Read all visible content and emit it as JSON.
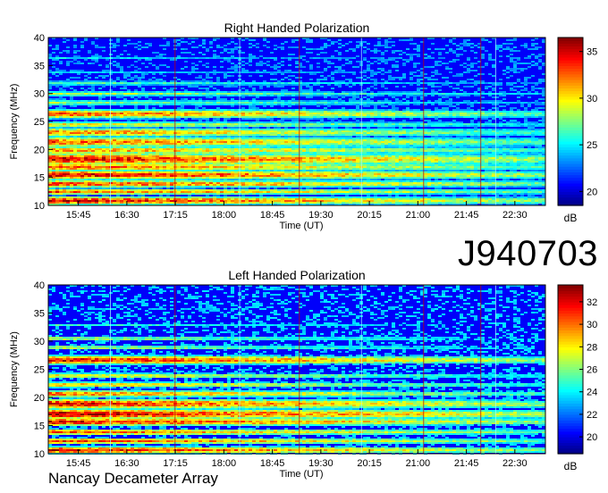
{
  "figure_id": "J940703",
  "footer": "Nancay Decameter Array",
  "chart_data": [
    {
      "type": "heatmap",
      "title": "Right Handed Polarization",
      "xlabel": "Time (UT)",
      "ylabel": "Frequency (MHz)",
      "xticks": [
        "15:45",
        "16:30",
        "17:15",
        "18:00",
        "18:45",
        "19:30",
        "20:15",
        "21:00",
        "21:45",
        "22:30"
      ],
      "yticks": [
        10,
        15,
        20,
        25,
        30,
        35,
        40
      ],
      "ylim": [
        10,
        40
      ],
      "colorbar": {
        "label": "dB",
        "ticks": [
          20,
          25,
          30,
          35
        ],
        "range": [
          18.5,
          36.5
        ]
      },
      "bands": [
        {
          "f": 11.0,
          "w": 0.8,
          "v": 35
        },
        {
          "f": 12.6,
          "w": 0.6,
          "v": 33
        },
        {
          "f": 14.0,
          "w": 0.7,
          "v": 34
        },
        {
          "f": 15.6,
          "w": 0.9,
          "v": 35
        },
        {
          "f": 17.0,
          "w": 0.8,
          "v": 33
        },
        {
          "f": 18.4,
          "w": 1.2,
          "v": 35
        },
        {
          "f": 20.0,
          "w": 0.8,
          "v": 32
        },
        {
          "f": 21.5,
          "w": 1.0,
          "v": 33
        },
        {
          "f": 23.2,
          "w": 0.9,
          "v": 32
        },
        {
          "f": 24.6,
          "w": 0.6,
          "v": 30
        },
        {
          "f": 26.5,
          "w": 0.9,
          "v": 33
        },
        {
          "f": 28.5,
          "w": 0.6,
          "v": 28
        },
        {
          "f": 30.1,
          "w": 0.5,
          "v": 29
        },
        {
          "f": 32.0,
          "w": 0.5,
          "v": 27
        },
        {
          "f": 34.0,
          "w": 0.4,
          "v": 25
        },
        {
          "f": 36.5,
          "w": 0.4,
          "v": 25
        }
      ]
    },
    {
      "type": "heatmap",
      "title": "Left Handed Polarization",
      "xlabel": "Time (UT)",
      "ylabel": "Frequency (MHz)",
      "xticks": [
        "15:45",
        "16:30",
        "17:15",
        "18:00",
        "18:45",
        "19:30",
        "20:15",
        "21:00",
        "21:45",
        "22:30"
      ],
      "yticks": [
        10,
        15,
        20,
        25,
        30,
        35,
        40
      ],
      "ylim": [
        10,
        40
      ],
      "colorbar": {
        "label": "dB",
        "ticks": [
          20,
          22,
          24,
          26,
          28,
          30,
          32
        ],
        "range": [
          18.5,
          33.5
        ]
      },
      "bands": [
        {
          "f": 10.8,
          "w": 0.7,
          "v": 32
        },
        {
          "f": 12.4,
          "w": 0.6,
          "v": 31
        },
        {
          "f": 14.0,
          "w": 0.6,
          "v": 31
        },
        {
          "f": 15.8,
          "w": 0.8,
          "v": 32
        },
        {
          "f": 17.2,
          "w": 1.0,
          "v": 33
        },
        {
          "f": 19.0,
          "w": 1.0,
          "v": 32
        },
        {
          "f": 20.8,
          "w": 0.7,
          "v": 30
        },
        {
          "f": 22.4,
          "w": 0.6,
          "v": 29
        },
        {
          "f": 24.0,
          "w": 0.6,
          "v": 28
        },
        {
          "f": 26.8,
          "w": 0.9,
          "v": 32
        },
        {
          "f": 29.0,
          "w": 0.5,
          "v": 27
        },
        {
          "f": 30.6,
          "w": 0.5,
          "v": 27
        },
        {
          "f": 33.0,
          "w": 0.4,
          "v": 25
        },
        {
          "f": 36.0,
          "w": 0.4,
          "v": 24
        }
      ]
    }
  ]
}
